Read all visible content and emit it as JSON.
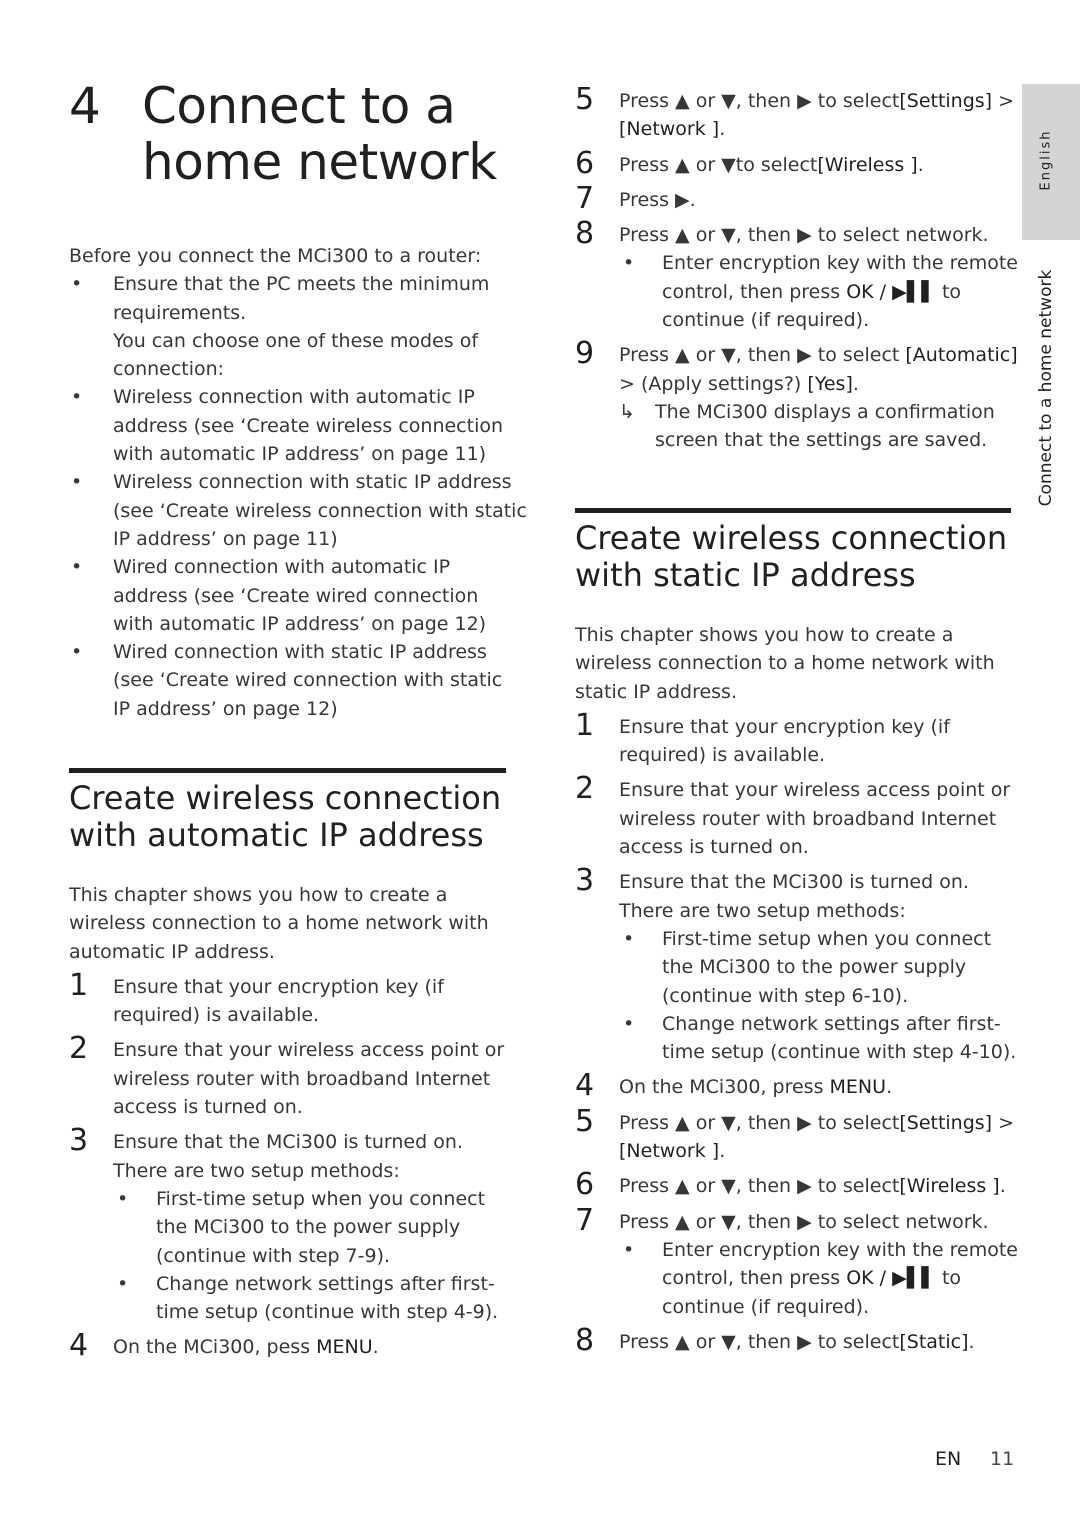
{
  "chapter": {
    "number": "4",
    "title_line1": "Connect to a",
    "title_line2": "home network"
  },
  "intro": {
    "lead": "Before you connect the MCi300 to a router:",
    "bullet1_lines": [
      "Ensure that the PC meets the minimum",
      "requirements."
    ],
    "note_lines": [
      "You can choose one of these modes of",
      "connection:"
    ],
    "modes": [
      {
        "lines": [
          "Wireless connection with automatic IP",
          "address (see ‘Create wireless connection",
          "with automatic IP address’ on page 11)"
        ]
      },
      {
        "lines": [
          "Wireless connection with static IP address",
          "(see ‘Create wireless connection with static",
          "IP address’ on page 11)"
        ]
      },
      {
        "lines": [
          "Wired connection with automatic IP",
          "address (see ‘Create wired connection",
          "with automatic IP address’ on page 12)"
        ]
      },
      {
        "lines": [
          "Wired connection with static IP address",
          "(see ‘Create wired connection with static",
          "IP address’ on page 12)"
        ]
      }
    ]
  },
  "section_auto": {
    "heading_line1": "Create wireless connection",
    "heading_line2": "with automatic IP address",
    "intro_lines": [
      "This chapter shows you how to create a",
      "wireless connection to a home network with",
      "automatic IP address."
    ],
    "steps": [
      {
        "n": "1",
        "lines": [
          "Ensure that your encryption key (if",
          "required) is available."
        ]
      },
      {
        "n": "2",
        "lines": [
          "Ensure that your wireless access point or",
          "wireless router with broadband Internet",
          "access is turned on."
        ]
      },
      {
        "n": "3",
        "lines": [
          "Ensure that the MCi300 is turned on.",
          "There are two setup methods:"
        ],
        "subs": [
          [
            "First-time setup when you connect",
            "the MCi300 to the power supply",
            "(continue with step 7-9)."
          ],
          [
            "Change network settings after first-",
            "time setup (continue with step 4-9)."
          ]
        ]
      },
      {
        "n": "4",
        "text": "On the MCi300, pess ",
        "key": "MENU",
        "end": "."
      },
      {
        "n": "5",
        "l1_pre": "Press ▲ or ▼, then ▶ to select",
        "l1_key": "[Settings]",
        "l1_post": " >",
        "l2_key": "[Network ]",
        "l2_post": "."
      },
      {
        "n": "6",
        "pre": "Press ▲ or ▼to select",
        "key": "[Wireless ]",
        "post": "."
      },
      {
        "n": "7",
        "text": "Press ▶."
      },
      {
        "n": "8",
        "text": "Press ▲ or ▼, then ▶ to select network.",
        "sub_l1": "Enter encryption key with the remote",
        "sub_l2_pre": "control, then press ",
        "sub_l2_key": "OK / ▶▌▌",
        "sub_l2_post": " to",
        "sub_l3": "continue (if required)."
      },
      {
        "n": "9",
        "pre": "Press ▲ or ▼, then ▶ to select ",
        "key": "[Automatic]",
        "l2_pre": "> (Apply settings?) ",
        "l2_key": "[Yes]",
        "l2_post": ".",
        "result_lines": [
          "The MCi300 displays a confirmation",
          "screen that the settings are saved."
        ]
      }
    ]
  },
  "section_static": {
    "heading_line1": "Create wireless connection",
    "heading_line2": "with static IP address",
    "intro_lines": [
      "This chapter shows you how to create a",
      "wireless connection to a home network with",
      "static IP address."
    ],
    "steps": [
      {
        "n": "1",
        "lines": [
          "Ensure that your encryption key (if",
          "required) is available."
        ]
      },
      {
        "n": "2",
        "lines": [
          "Ensure that your wireless access point or",
          "wireless router with broadband Internet",
          "access is turned on."
        ]
      },
      {
        "n": "3",
        "lines": [
          "Ensure that the MCi300 is turned on.",
          "There are two setup methods:"
        ],
        "subs": [
          [
            "First-time setup when you connect",
            "the MCi300 to the power supply",
            "(continue with step 6-10)."
          ],
          [
            "Change network settings after first-",
            "time setup (continue with step 4-10)."
          ]
        ]
      },
      {
        "n": "4",
        "text": "On the MCi300, press ",
        "key": "MENU",
        "end": "."
      },
      {
        "n": "5",
        "l1_pre": "Press ▲ or ▼, then ▶ to select",
        "l1_key": "[Settings]",
        "l1_post": " >",
        "l2_key": "[Network ]",
        "l2_post": "."
      },
      {
        "n": "6",
        "pre": "Press ▲ or ▼, then ▶ to select",
        "key": "[Wireless ]",
        "post": "."
      },
      {
        "n": "7",
        "text": "Press ▲ or ▼, then ▶ to select network.",
        "sub_l1": "Enter encryption key with the remote",
        "sub_l2_pre": "control, then press ",
        "sub_l2_key": "OK / ▶▌▌",
        "sub_l2_post": " to",
        "sub_l3": "continue (if required)."
      },
      {
        "n": "8",
        "pre": "Press ▲ or ▼, then ▶ to select",
        "key": "[Static]",
        "post": "."
      }
    ]
  },
  "sidebar": {
    "language_tab": "English",
    "section_label": "Connect to a home network",
    "tab_color": "#d4d4d4"
  },
  "footer": {
    "lang": "EN",
    "page": "11"
  },
  "icons": {
    "bullet": "•",
    "result_arrow": "↳"
  }
}
